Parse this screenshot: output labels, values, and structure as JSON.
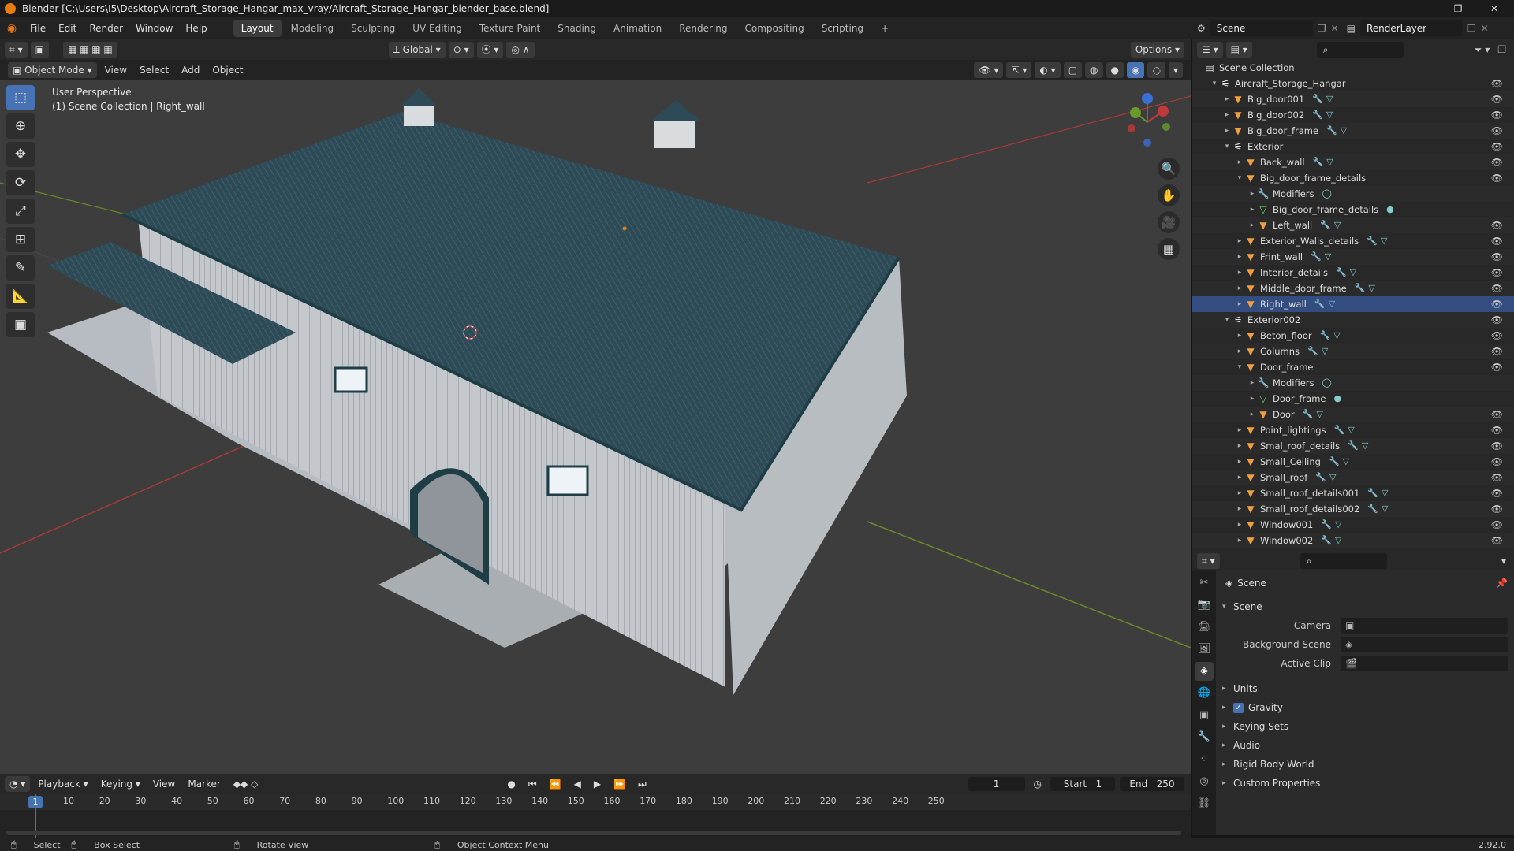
{
  "window": {
    "title": "Blender [C:\\Users\\I5\\Desktop\\Aircraft_Storage_Hangar_max_vray/Aircraft_Storage_Hangar_blender_base.blend]",
    "minimize": "—",
    "maximize": "❐",
    "close": "✕"
  },
  "menu": [
    "File",
    "Edit",
    "Render",
    "Window",
    "Help"
  ],
  "workspaces": [
    "Layout",
    "Modeling",
    "Sculpting",
    "UV Editing",
    "Texture Paint",
    "Shading",
    "Animation",
    "Rendering",
    "Compositing",
    "Scripting"
  ],
  "workspace_add": "+",
  "scene_name": "Scene",
  "render_layer": "RenderLayer",
  "viewport_header": {
    "transform_orientation": "Global",
    "options_label": "Options"
  },
  "viewport_menu": {
    "mode": "Object Mode",
    "items": [
      "View",
      "Select",
      "Add",
      "Object"
    ]
  },
  "viewport_info": {
    "perspective": "User Perspective",
    "context": "(1) Scene Collection | Right_wall"
  },
  "gizmo_axes": {
    "x": "X",
    "y": "Y",
    "z": "Z"
  },
  "outliner": {
    "root": "Scene Collection",
    "rows": [
      {
        "label": "Aircraft_Storage_Hangar",
        "indent": 1,
        "icon": "collection-icon",
        "tri": "▾"
      },
      {
        "label": "Big_door001",
        "indent": 2,
        "icon": "mesh-object-icon",
        "tri": "▸",
        "extra": "🔧▽"
      },
      {
        "label": "Big_door002",
        "indent": 2,
        "icon": "mesh-object-icon",
        "tri": "▸",
        "extra": "🔧▽"
      },
      {
        "label": "Big_door_frame",
        "indent": 2,
        "icon": "mesh-object-icon",
        "tri": "▸",
        "extra": "🔧▽"
      },
      {
        "label": "Exterior",
        "indent": 2,
        "icon": "collection-icon",
        "tri": "▾"
      },
      {
        "label": "Back_wall",
        "indent": 3,
        "icon": "mesh-object-icon",
        "tri": "▸",
        "extra": "🔧▽"
      },
      {
        "label": "Big_door_frame_details",
        "indent": 3,
        "icon": "mesh-object-icon",
        "tri": "▾"
      },
      {
        "label": "Modifiers",
        "indent": 4,
        "icon": "wrench-icon",
        "tri": "▸",
        "extra": "◯"
      },
      {
        "label": "Big_door_frame_details",
        "indent": 4,
        "icon": "mesh-data-icon",
        "tri": "▸",
        "extra": "●"
      },
      {
        "label": "Left_wall",
        "indent": 4,
        "icon": "mesh-object-icon",
        "tri": "▸",
        "extra": "🔧▽"
      },
      {
        "label": "Exterior_Walls_details",
        "indent": 3,
        "icon": "mesh-object-icon",
        "tri": "▸",
        "extra": "🔧▽"
      },
      {
        "label": "Frint_wall",
        "indent": 3,
        "icon": "mesh-object-icon",
        "tri": "▸",
        "extra": "🔧▽"
      },
      {
        "label": "Interior_details",
        "indent": 3,
        "icon": "mesh-object-icon",
        "tri": "▸",
        "extra": "🔧▽"
      },
      {
        "label": "Middle_door_frame",
        "indent": 3,
        "icon": "mesh-object-icon",
        "tri": "▸",
        "extra": "🔧▽"
      },
      {
        "label": "Right_wall",
        "indent": 3,
        "icon": "mesh-object-icon",
        "tri": "▸",
        "extra": "🔧▽",
        "selected": true
      },
      {
        "label": "Exterior002",
        "indent": 2,
        "icon": "collection-icon",
        "tri": "▾"
      },
      {
        "label": "Beton_floor",
        "indent": 3,
        "icon": "mesh-object-icon",
        "tri": "▸",
        "extra": "🔧▽"
      },
      {
        "label": "Columns",
        "indent": 3,
        "icon": "mesh-object-icon",
        "tri": "▸",
        "extra": "🔧▽"
      },
      {
        "label": "Door_frame",
        "indent": 3,
        "icon": "mesh-object-icon",
        "tri": "▾"
      },
      {
        "label": "Modifiers",
        "indent": 4,
        "icon": "wrench-icon",
        "tri": "▸",
        "extra": "◯"
      },
      {
        "label": "Door_frame",
        "indent": 4,
        "icon": "mesh-data-icon",
        "tri": "▸",
        "extra": "●"
      },
      {
        "label": "Door",
        "indent": 4,
        "icon": "mesh-object-icon",
        "tri": "▸",
        "extra": "🔧▽"
      },
      {
        "label": "Point_lightings",
        "indent": 3,
        "icon": "mesh-object-icon",
        "tri": "▸",
        "extra": "🔧▽"
      },
      {
        "label": "Smal_roof_details",
        "indent": 3,
        "icon": "mesh-object-icon",
        "tri": "▸",
        "extra": "🔧▽"
      },
      {
        "label": "Small_Ceiling",
        "indent": 3,
        "icon": "mesh-object-icon",
        "tri": "▸",
        "extra": "🔧▽"
      },
      {
        "label": "Small_roof",
        "indent": 3,
        "icon": "mesh-object-icon",
        "tri": "▸",
        "extra": "🔧▽"
      },
      {
        "label": "Small_roof_details001",
        "indent": 3,
        "icon": "mesh-object-icon",
        "tri": "▸",
        "extra": "🔧▽"
      },
      {
        "label": "Small_roof_details002",
        "indent": 3,
        "icon": "mesh-object-icon",
        "tri": "▸",
        "extra": "🔧▽"
      },
      {
        "label": "Window001",
        "indent": 3,
        "icon": "mesh-object-icon",
        "tri": "▸",
        "extra": "🔧▽"
      },
      {
        "label": "Window002",
        "indent": 3,
        "icon": "mesh-object-icon",
        "tri": "▸",
        "extra": "🔧▽"
      }
    ]
  },
  "properties": {
    "context": "Scene",
    "panel_title": "Scene",
    "fields": [
      {
        "label": "Camera",
        "value": ""
      },
      {
        "label": "Background Scene",
        "value": ""
      },
      {
        "label": "Active Clip",
        "value": ""
      }
    ],
    "sections": [
      "Units",
      "Gravity",
      "Keying Sets",
      "Audio",
      "Rigid Body World",
      "Custom Properties"
    ],
    "gravity_checked": true
  },
  "timeline": {
    "menus": [
      "Playback",
      "Keying",
      "View",
      "Marker"
    ],
    "current_frame": "1",
    "start_label": "Start",
    "start": "1",
    "end_label": "End",
    "end": "250",
    "ruler": [
      "10",
      "20",
      "30",
      "40",
      "50",
      "60",
      "70",
      "80",
      "90",
      "100",
      "110",
      "120",
      "130",
      "140",
      "150",
      "160",
      "170",
      "180",
      "190",
      "200",
      "210",
      "220",
      "230",
      "240",
      "250"
    ],
    "playhead": "1"
  },
  "statusbar": {
    "items": [
      "Select",
      "Box Select",
      "Rotate View",
      "Object Context Menu"
    ],
    "version": "2.92.0"
  },
  "colors": {
    "accent": "#4772b3",
    "roof": "#2e4a56",
    "wall": "#c8ccd0",
    "trim": "#1f3d44",
    "floor": "#b7bcc2",
    "grid_x": "#a83a3a",
    "grid_y": "#6a8a2a"
  }
}
